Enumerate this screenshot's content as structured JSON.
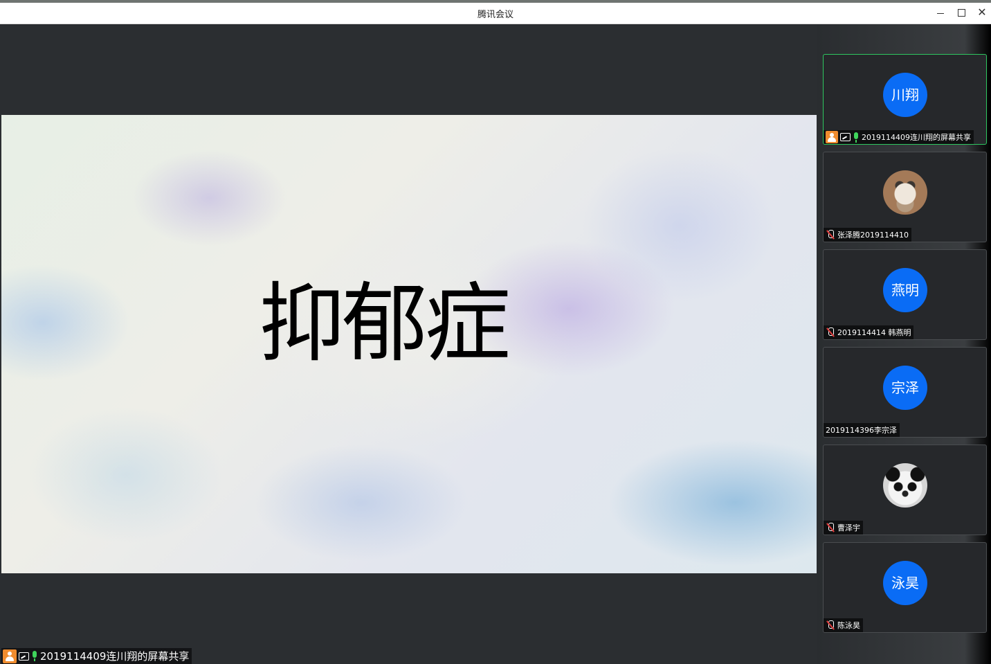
{
  "window": {
    "title": "腾讯会议"
  },
  "main": {
    "slide_title": "抑郁症",
    "share_label": "2019114409连川翔的屏幕共享"
  },
  "participants": [
    {
      "avatar_text": "川翔",
      "name": "2019114409连川翔的屏幕共享",
      "host": true,
      "sharing": true,
      "mic": "on",
      "active": true
    },
    {
      "avatar_text": "",
      "avatar_type": "photo-dog",
      "name": "张泽腾2019114410",
      "mic": "muted"
    },
    {
      "avatar_text": "燕明",
      "name": "2019114414 韩燕明",
      "mic": "muted"
    },
    {
      "avatar_text": "宗泽",
      "name": "2019114396李宗泽",
      "mic": "none"
    },
    {
      "avatar_text": "",
      "avatar_type": "photo-panda",
      "name": "曹泽宇",
      "mic": "muted"
    },
    {
      "avatar_text": "泳昊",
      "name": "陈泳昊",
      "mic": "muted"
    }
  ],
  "colors": {
    "avatar_blue": "#0a6cf5",
    "active_border": "#2ec760",
    "host_badge": "#f08c2e",
    "mic_on": "#3fd45b",
    "mic_muted_slash": "#e23c3c"
  }
}
